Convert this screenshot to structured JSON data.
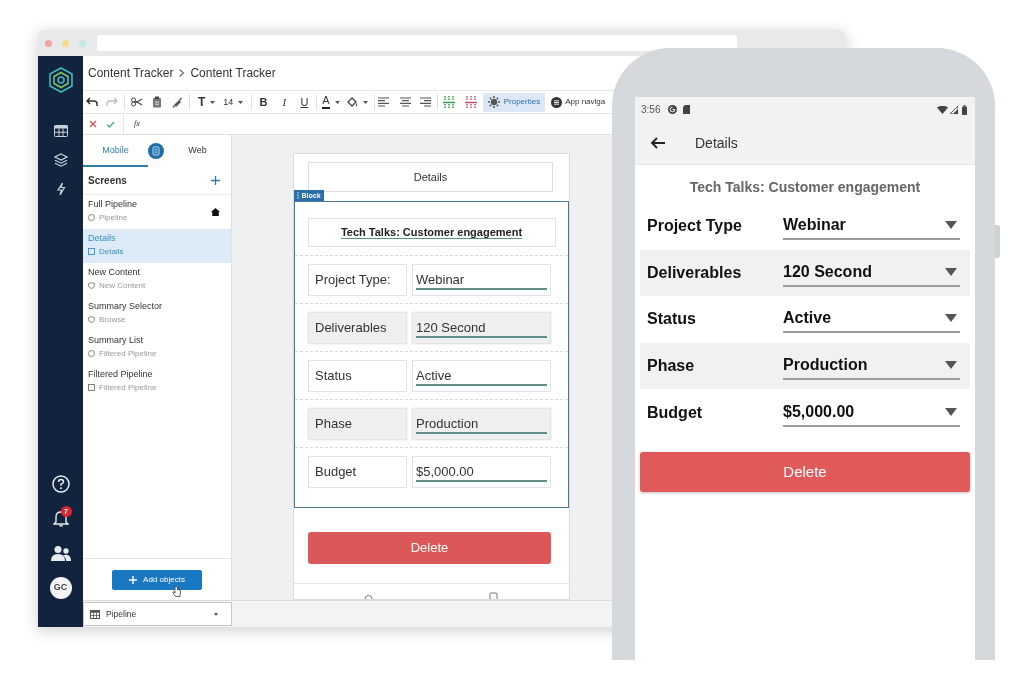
{
  "app_header": {
    "breadcrumb": [
      {
        "label": "Content Tracker"
      },
      {
        "label": "Content Tracker"
      }
    ]
  },
  "nav_rail": {
    "notification_count": "7",
    "avatar_initials": "GC"
  },
  "toolbar": {
    "undo": {
      "disabled": false
    },
    "redo": {
      "disabled": true
    },
    "font_button": "T",
    "font_size": "14",
    "format_buttons": [
      {
        "label": "B",
        "kind": "bold"
      },
      {
        "label": "I",
        "kind": "italic"
      },
      {
        "label": "U",
        "kind": "underline"
      }
    ],
    "text_color_button": "A",
    "properties_button": {
      "label": "Properties",
      "selected": true
    },
    "app_navigation_button": {
      "label": "App naviga",
      "selected": false
    }
  },
  "formula_bar": {
    "function_button": "fx"
  },
  "sidebar": {
    "tabs": [
      {
        "label": "Mobile",
        "selected": true
      },
      {
        "label": "Web",
        "selected": false
      }
    ],
    "screens_title": "Screens",
    "screens": [
      {
        "name": "Full Pipeline",
        "source": "Pipeline",
        "kind": "list",
        "home": true,
        "selected": false
      },
      {
        "name": "Details",
        "source": "Details",
        "kind": "details",
        "home": false,
        "selected": true
      },
      {
        "name": "New Content",
        "source": "New Content",
        "kind": "form",
        "home": false,
        "selected": false
      },
      {
        "name": "Summary Selector",
        "source": "Browse",
        "kind": "form",
        "home": false,
        "selected": false
      },
      {
        "name": "Summary List",
        "source": "Filtered Pipeline",
        "kind": "list",
        "home": false,
        "selected": false
      },
      {
        "name": "Filtered Pipeline",
        "source": "Filtered Pipeline",
        "kind": "details",
        "home": false,
        "selected": false
      }
    ],
    "add_button": "Add objects"
  },
  "table_selector": {
    "value": "Pipeline"
  },
  "canvas": {
    "header": "Details",
    "block_label": "Block",
    "title": "Tech Talks: Customer engagement",
    "fields": [
      {
        "label": "Project Type:",
        "value": "Webinar"
      },
      {
        "label": "Deliverables",
        "value": "120 Second"
      },
      {
        "label": "Status",
        "value": "Active"
      },
      {
        "label": "Phase",
        "value": "Production"
      },
      {
        "label": "Budget",
        "value": "$5,000.00"
      }
    ],
    "delete_button": "Delete"
  },
  "phone": {
    "status_bar": {
      "time": "3:56"
    },
    "app_bar": {
      "title": "Details"
    },
    "title": "Tech Talks: Customer engagement",
    "fields": [
      {
        "label": "Project Type",
        "value": "Webinar"
      },
      {
        "label": "Deliverables",
        "value": "120 Second"
      },
      {
        "label": "Status",
        "value": "Active"
      },
      {
        "label": "Phase",
        "value": "Production"
      },
      {
        "label": "Budget",
        "value": "$5,000.00"
      }
    ],
    "delete_button": "Delete"
  }
}
